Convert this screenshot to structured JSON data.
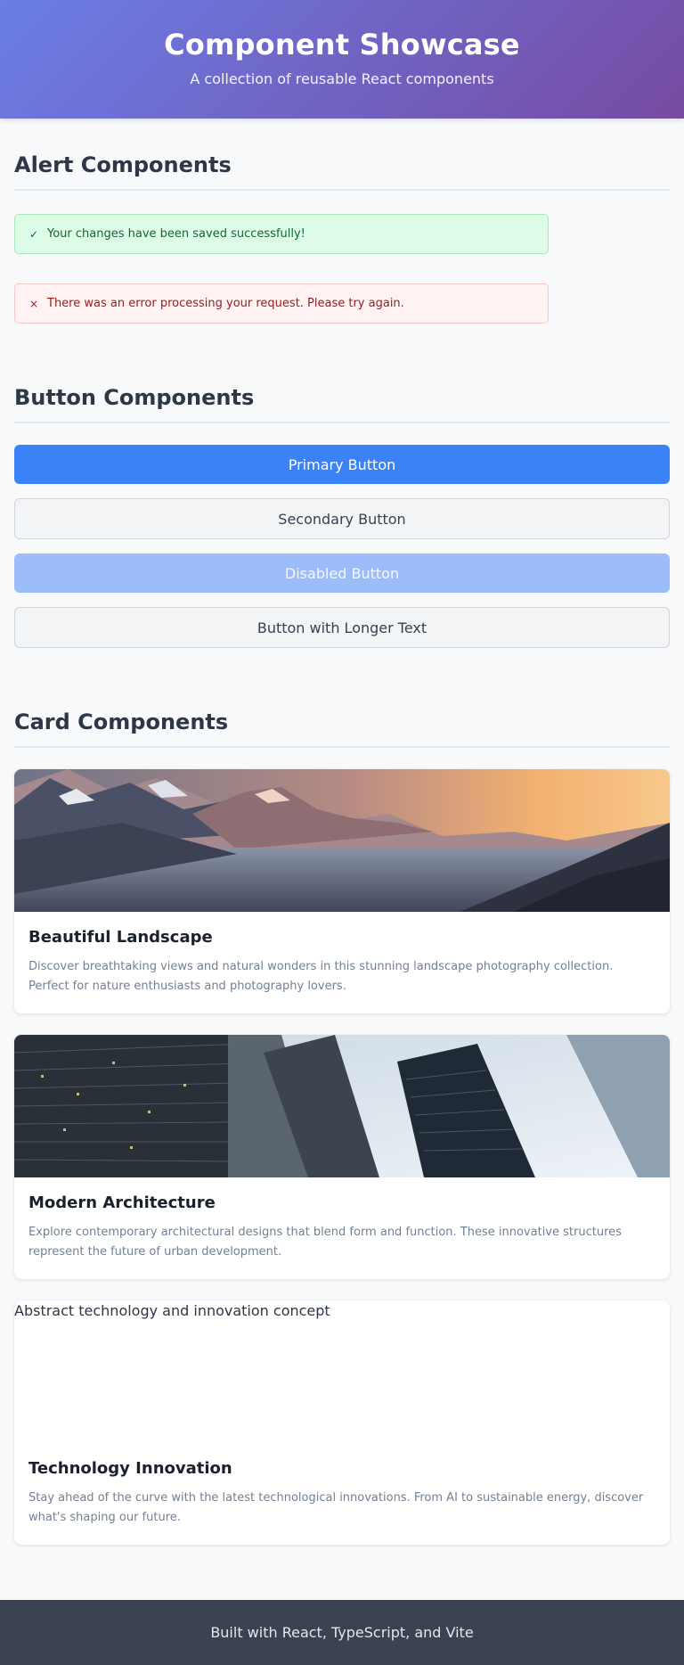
{
  "header": {
    "title": "Component Showcase",
    "subtitle": "A collection of reusable React components"
  },
  "alerts": {
    "title": "Alert Components",
    "success": {
      "icon": "check-icon",
      "glyph": "✓",
      "text": "Your changes have been saved successfully!"
    },
    "error": {
      "icon": "close-icon",
      "glyph": "×",
      "text": "There was an error processing your request. Please try again."
    }
  },
  "buttons": {
    "title": "Button Components",
    "primary": "Primary Button",
    "secondary": "Secondary Button",
    "disabled": "Disabled Button",
    "longer": "Button with Longer Text"
  },
  "cards": {
    "title": "Card Components",
    "items": [
      {
        "title": "Beautiful Landscape",
        "description": "Discover breathtaking views and natural wonders in this stunning landscape photography collection. Perfect for nature enthusiasts and photography lovers."
      },
      {
        "title": "Modern Architecture",
        "description": "Explore contemporary architectural designs that blend form and function. These innovative structures represent the future of urban development."
      },
      {
        "title": "Technology Innovation",
        "image_alt": "Abstract technology and innovation concept",
        "description": "Stay ahead of the curve with the latest technological innovations. From AI to sustainable energy, discover what's shaping our future."
      }
    ]
  },
  "footer": {
    "text": "Built with React, TypeScript, and Vite"
  },
  "colors": {
    "header_gradient_start": "#6a7ee6",
    "header_gradient_end": "#764ba2",
    "primary": "#3b82f6",
    "success_bg": "#dcfce7",
    "error_bg": "#fef2f2",
    "footer_bg": "#3b4252"
  }
}
